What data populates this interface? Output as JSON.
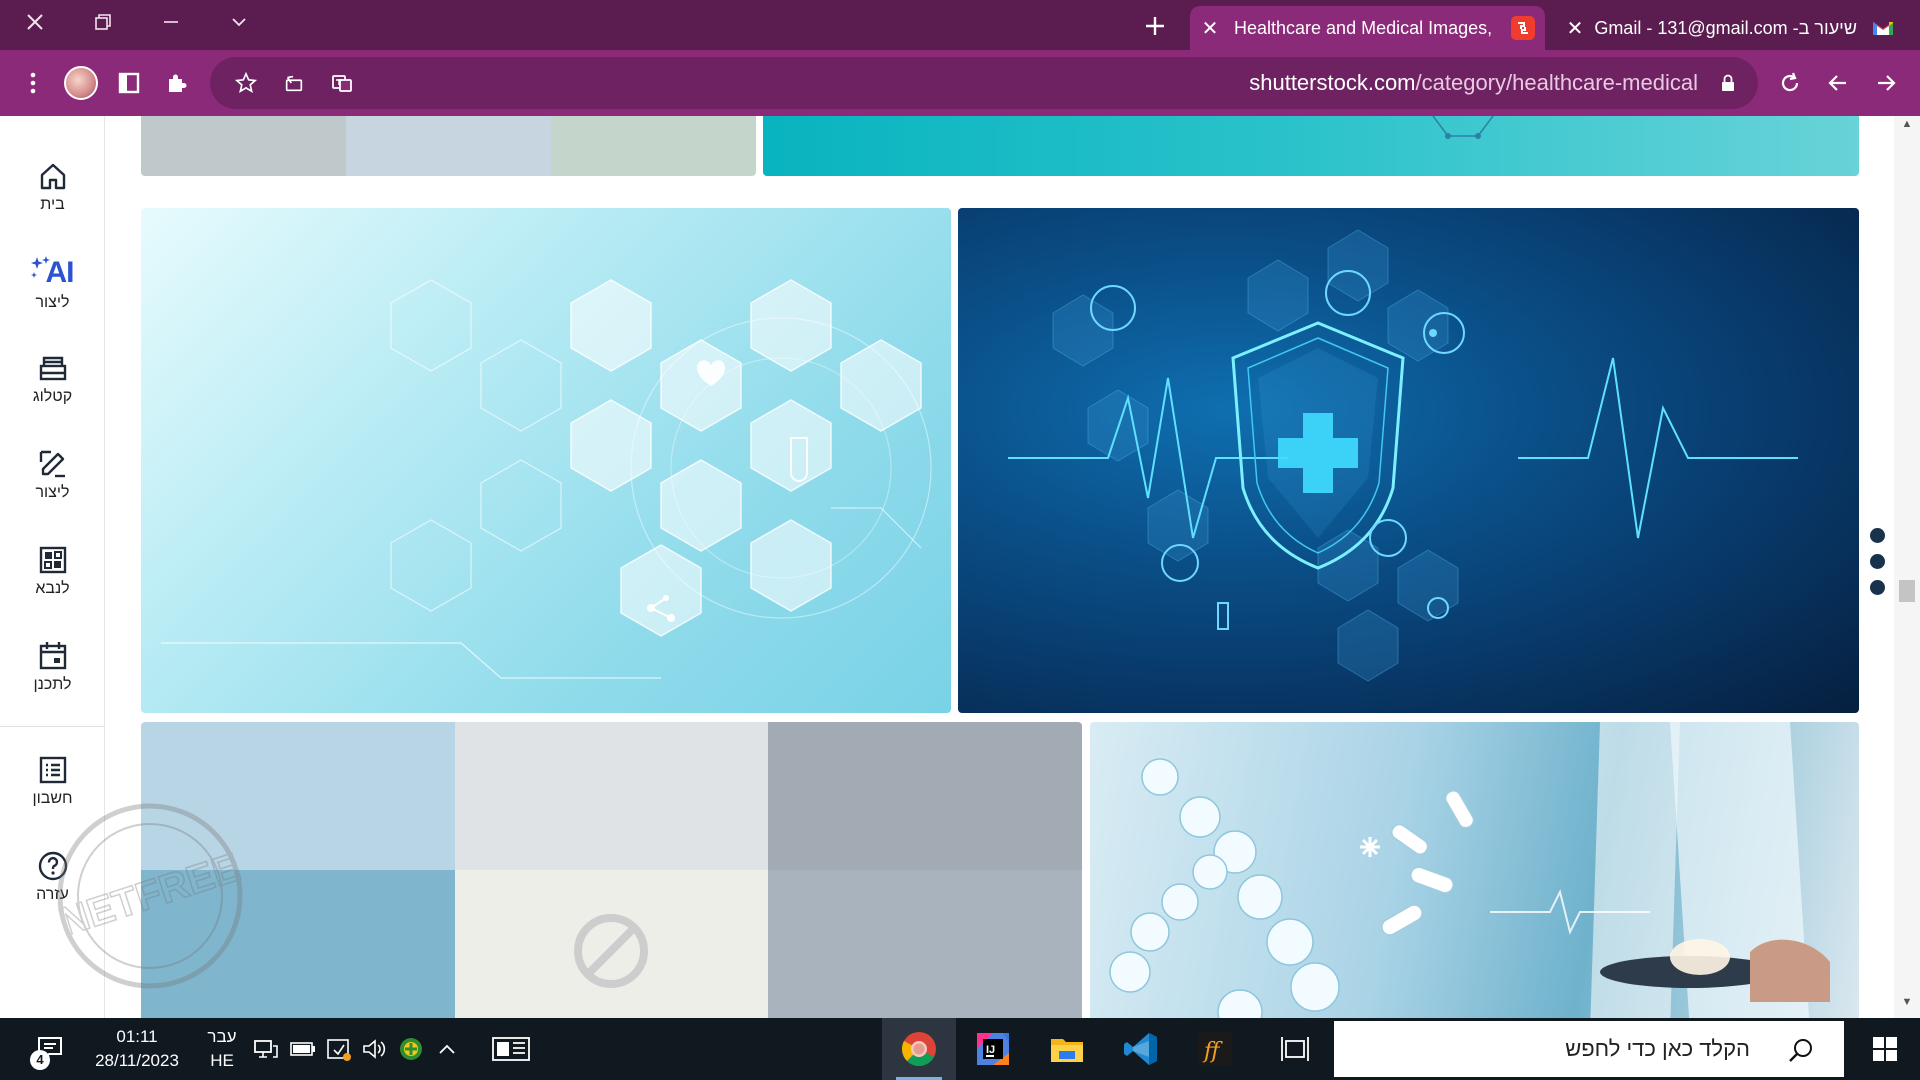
{
  "browser": {
    "tabs": [
      {
        "title": "Healthcare and Medical Images,",
        "active": true
      },
      {
        "title": "שיעור ב- Gmail - 131@gmail.com",
        "active": false
      }
    ],
    "url_host": "shutterstock.com",
    "url_path": "/category/healthcare-medical"
  },
  "sidebar": {
    "items": [
      {
        "label": "בית",
        "icon": "home-icon"
      },
      {
        "label": "ליצור",
        "icon": "ai-icon",
        "badge": "AI"
      },
      {
        "label": "קטלוג",
        "icon": "catalog-icon"
      },
      {
        "label": "ליצור",
        "icon": "edit-icon"
      },
      {
        "label": "לנבא",
        "icon": "dashboard-icon"
      },
      {
        "label": "לתכנן",
        "icon": "calendar-icon"
      },
      {
        "label": "חשבון",
        "icon": "account-list-icon"
      },
      {
        "label": "עזרה",
        "icon": "help-icon"
      }
    ]
  },
  "watermark": {
    "text": "NETFREE"
  },
  "taskbar": {
    "notifications_count": "4",
    "time": "01:11",
    "date": "28/11/2023",
    "language_line1": "עבר",
    "language_line2": "HE",
    "search_placeholder": "הקלד כאן כדי לחפש"
  },
  "colors": {
    "tabstrip": "#5b1d4f",
    "toolbar": "#8b2a78",
    "ai_accent": "#2b52d1",
    "taskbar": "#101820"
  }
}
